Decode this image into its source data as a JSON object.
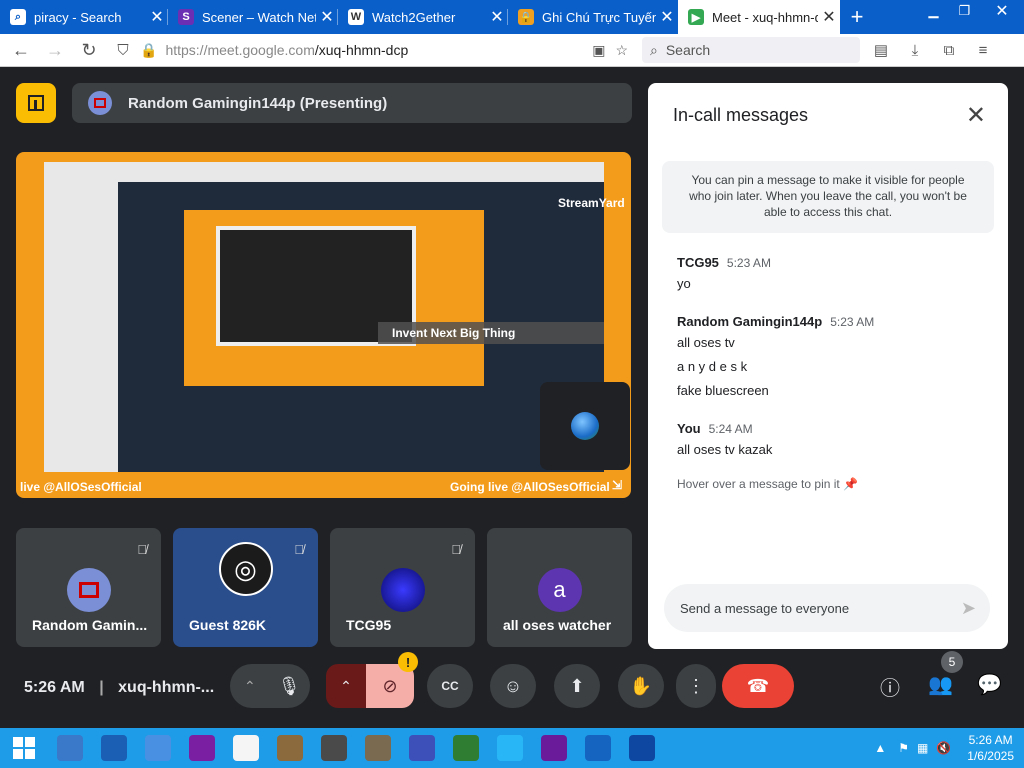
{
  "browser": {
    "tabs": [
      {
        "label": "piracy - Search",
        "icon": "search-icon",
        "active": false
      },
      {
        "label": "Scener – Watch Netfl",
        "icon": "scener-icon",
        "active": false
      },
      {
        "label": "Watch2Gether",
        "icon": "w2g-icon",
        "active": false
      },
      {
        "label": "Ghi Chú Trực Tuyến",
        "icon": "lock-icon",
        "active": false
      },
      {
        "label": "Meet - xuq-hhmn-d",
        "icon": "meet-icon",
        "active": true
      }
    ],
    "url_host": "https://meet.google.com",
    "url_path": "/xuq-hhmn-dcp",
    "search_label": "Search"
  },
  "meet": {
    "presenter_label": "Random Gamingin144p (Presenting)",
    "screenshare": {
      "caption_left": "live @AllOSesOfficial",
      "caption_right": "Going live @AllOSesOfficial",
      "overlay_text": "Invent Next Big Thing",
      "brand": "StreamYard"
    },
    "participants": [
      {
        "name": "Random Gamin...",
        "avatar": "square-icon",
        "color": "#7b8fd6"
      },
      {
        "name": "Guest 826K",
        "avatar": "obs-icon",
        "color": "#1b1b1b"
      },
      {
        "name": "TCG95",
        "avatar": "blue-orb-icon",
        "color": "#1a1aa8"
      },
      {
        "name": "all oses watcher",
        "avatar": "a",
        "color": "#5e35b1"
      }
    ],
    "time": "5:26 AM",
    "meeting_code": "xuq-hhmn-...",
    "people_count": "5",
    "warn_badge": "!",
    "cc_label": "CC"
  },
  "chat": {
    "title": "In-call messages",
    "pin_note": "You can pin a message to make it visible for people who join later. When you leave the call, you won't be able to access this chat.",
    "messages": [
      {
        "sender": "TCG95",
        "time": "5:23 AM",
        "lines": [
          "yo"
        ]
      },
      {
        "sender": "Random Gamingin144p",
        "time": "5:23 AM",
        "lines": [
          "all oses tv",
          "a n y d e s k",
          "fake bluescreen"
        ]
      },
      {
        "sender": "You",
        "time": "5:24 AM",
        "lines": [
          "all oses tv kazak"
        ]
      }
    ],
    "hover_note": "Hover over a message to pin it",
    "send_placeholder": "Send a message to everyone"
  },
  "taskbar": {
    "time": "5:26 AM",
    "date": "1/6/2025",
    "apps": [
      {
        "name": "file-manager-icon",
        "color": "#3a78c9"
      },
      {
        "name": "powershell-icon",
        "color": "#1a5fb4"
      },
      {
        "name": "sync-icon",
        "color": "#4a90e2"
      },
      {
        "name": "yahoo-messenger-icon",
        "color": "#7b1fa2"
      },
      {
        "name": "document-icon",
        "color": "#f5f5f5"
      },
      {
        "name": "minecraft-icon",
        "color": "#8b6a3e"
      },
      {
        "name": "media-player-icon",
        "color": "#4a4a4a"
      },
      {
        "name": "gimp-icon",
        "color": "#7a6a50"
      },
      {
        "name": "gear-ball-icon",
        "color": "#3d4fb8"
      },
      {
        "name": "computer-99-icon",
        "color": "#2e7d32"
      },
      {
        "name": "w-app-icon",
        "color": "#29b6f6"
      },
      {
        "name": "yahoo-icon",
        "color": "#6a1b9a"
      },
      {
        "name": "f-app-icon",
        "color": "#1565c0"
      },
      {
        "name": "network-pc-icon",
        "color": "#0d47a1"
      }
    ]
  }
}
